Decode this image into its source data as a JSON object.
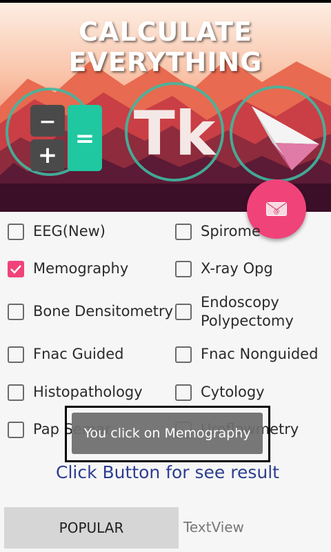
{
  "banner": {
    "title": "CALCULATE EVERYTHING",
    "tk_letters": "Tk",
    "minus_glyph": "−",
    "plus_glyph": "+",
    "equals_glyph": "="
  },
  "fab": {
    "icon": "mail-icon"
  },
  "checkboxes": [
    {
      "label": "EEG(New)",
      "checked": false
    },
    {
      "label": "Spirome",
      "checked": false
    },
    {
      "label": "Memography",
      "checked": true
    },
    {
      "label": "X-ray Opg",
      "checked": false
    },
    {
      "label": "Bone Densitometry",
      "checked": false
    },
    {
      "label": "Endoscopy",
      "label2": "Polypectomy",
      "checked": false
    },
    {
      "label": "Fnac Guided",
      "checked": false
    },
    {
      "label": "Fnac Nonguided",
      "checked": false
    },
    {
      "label": "Histopathology",
      "checked": false
    },
    {
      "label": "Cytology",
      "checked": false
    },
    {
      "label": "Pap Semar",
      "checked": false
    },
    {
      "label": "Uroflowmetry",
      "checked": false
    }
  ],
  "toast": {
    "message": "You click on Memography"
  },
  "result_link": "Click Button for see result",
  "popular_button": "POPULAR",
  "textview": "TextView",
  "colors": {
    "accent": "#f0437a",
    "link": "#2c3e8f",
    "teal": "#1fc8a0"
  }
}
